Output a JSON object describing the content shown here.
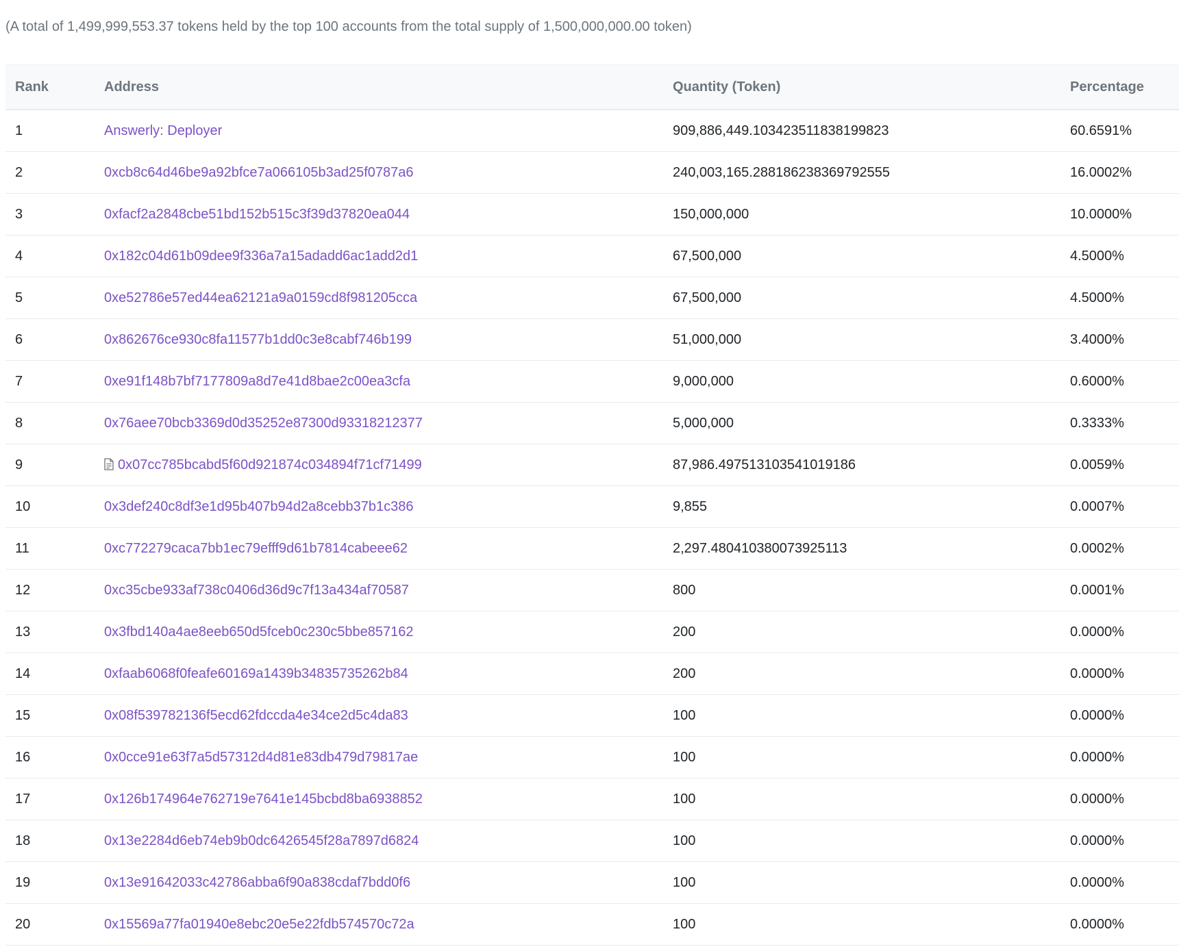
{
  "summary": "(A total of 1,499,999,553.37 tokens held by the top 100 accounts from the total supply of 1,500,000,000.00 token)",
  "columns": {
    "rank": "Rank",
    "address": "Address",
    "quantity": "Quantity (Token)",
    "percentage": "Percentage"
  },
  "colors": {
    "link": "#7b52c7",
    "header_bg": "#f8f9fa",
    "muted_text": "#6c757d"
  },
  "rows": [
    {
      "rank": "1",
      "address": "Answerly: Deployer",
      "is_contract": false,
      "quantity": "909,886,449.103423511838199823",
      "percentage": "60.6591%"
    },
    {
      "rank": "2",
      "address": "0xcb8c64d46be9a92bfce7a066105b3ad25f0787a6",
      "is_contract": false,
      "quantity": "240,003,165.288186238369792555",
      "percentage": "16.0002%"
    },
    {
      "rank": "3",
      "address": "0xfacf2a2848cbe51bd152b515c3f39d37820ea044",
      "is_contract": false,
      "quantity": "150,000,000",
      "percentage": "10.0000%"
    },
    {
      "rank": "4",
      "address": "0x182c04d61b09dee9f336a7a15adadd6ac1add2d1",
      "is_contract": false,
      "quantity": "67,500,000",
      "percentage": "4.5000%"
    },
    {
      "rank": "5",
      "address": "0xe52786e57ed44ea62121a9a0159cd8f981205cca",
      "is_contract": false,
      "quantity": "67,500,000",
      "percentage": "4.5000%"
    },
    {
      "rank": "6",
      "address": "0x862676ce930c8fa11577b1dd0c3e8cabf746b199",
      "is_contract": false,
      "quantity": "51,000,000",
      "percentage": "3.4000%"
    },
    {
      "rank": "7",
      "address": "0xe91f148b7bf7177809a8d7e41d8bae2c00ea3cfa",
      "is_contract": false,
      "quantity": "9,000,000",
      "percentage": "0.6000%"
    },
    {
      "rank": "8",
      "address": "0x76aee70bcb3369d0d35252e87300d93318212377",
      "is_contract": false,
      "quantity": "5,000,000",
      "percentage": "0.3333%"
    },
    {
      "rank": "9",
      "address": "0x07cc785bcabd5f60d921874c034894f71cf71499",
      "is_contract": true,
      "quantity": "87,986.497513103541019186",
      "percentage": "0.0059%"
    },
    {
      "rank": "10",
      "address": "0x3def240c8df3e1d95b407b94d2a8cebb37b1c386",
      "is_contract": false,
      "quantity": "9,855",
      "percentage": "0.0007%"
    },
    {
      "rank": "11",
      "address": "0xc772279caca7bb1ec79efff9d61b7814cabeee62",
      "is_contract": false,
      "quantity": "2,297.480410380073925113",
      "percentage": "0.0002%"
    },
    {
      "rank": "12",
      "address": "0xc35cbe933af738c0406d36d9c7f13a434af70587",
      "is_contract": false,
      "quantity": "800",
      "percentage": "0.0001%"
    },
    {
      "rank": "13",
      "address": "0x3fbd140a4ae8eeb650d5fceb0c230c5bbe857162",
      "is_contract": false,
      "quantity": "200",
      "percentage": "0.0000%"
    },
    {
      "rank": "14",
      "address": "0xfaab6068f0feafe60169a1439b34835735262b84",
      "is_contract": false,
      "quantity": "200",
      "percentage": "0.0000%"
    },
    {
      "rank": "15",
      "address": "0x08f539782136f5ecd62fdccda4e34ce2d5c4da83",
      "is_contract": false,
      "quantity": "100",
      "percentage": "0.0000%"
    },
    {
      "rank": "16",
      "address": "0x0cce91e63f7a5d57312d4d81e83db479d79817ae",
      "is_contract": false,
      "quantity": "100",
      "percentage": "0.0000%"
    },
    {
      "rank": "17",
      "address": "0x126b174964e762719e7641e145bcbd8ba6938852",
      "is_contract": false,
      "quantity": "100",
      "percentage": "0.0000%"
    },
    {
      "rank": "18",
      "address": "0x13e2284d6eb74eb9b0dc6426545f28a7897d6824",
      "is_contract": false,
      "quantity": "100",
      "percentage": "0.0000%"
    },
    {
      "rank": "19",
      "address": "0x13e91642033c42786abba6f90a838cdaf7bdd0f6",
      "is_contract": false,
      "quantity": "100",
      "percentage": "0.0000%"
    },
    {
      "rank": "20",
      "address": "0x15569a77fa01940e8ebc20e5e22fdb574570c72a",
      "is_contract": false,
      "quantity": "100",
      "percentage": "0.0000%"
    }
  ]
}
